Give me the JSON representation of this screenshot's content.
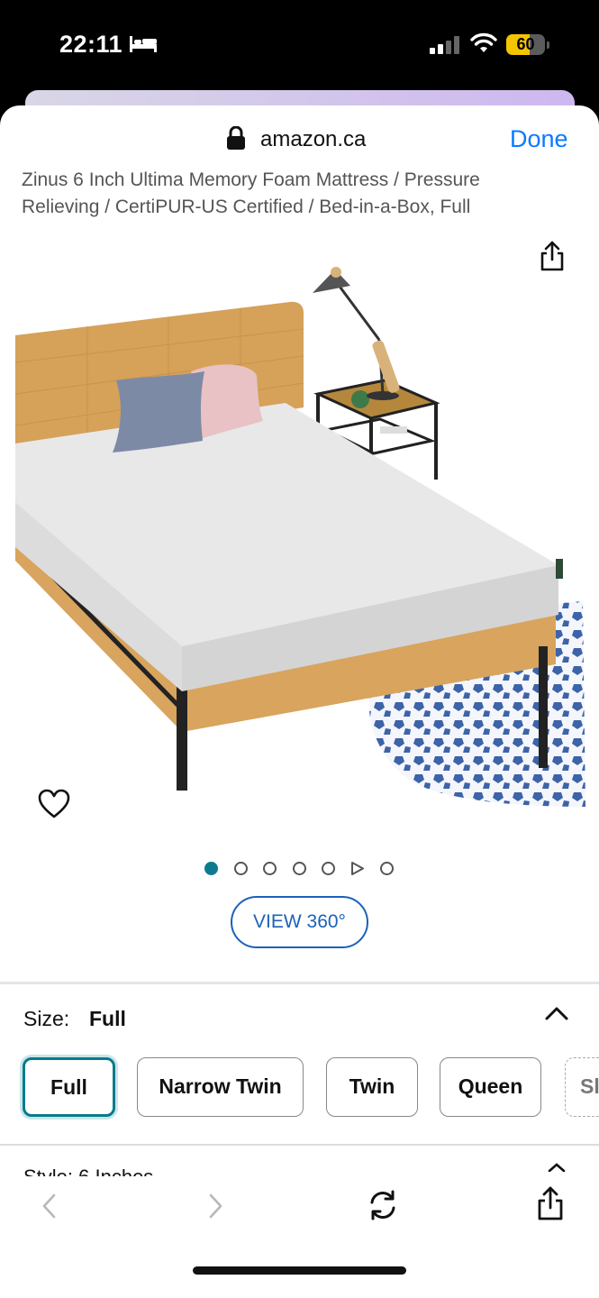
{
  "status_bar": {
    "time": "22:11",
    "battery_level": "60",
    "battery_fraction": 0.6,
    "icons": [
      "bed-icon",
      "signal-icon",
      "wifi-icon",
      "battery-icon"
    ]
  },
  "browser": {
    "url": "amazon.ca",
    "done_label": "Done"
  },
  "product": {
    "title": "Zinus 6 Inch Ultima Memory Foam Mattress / Pressure Relieving / CertiPUR-US Certified / Bed-in-a-Box, Full",
    "view360_label": "VIEW 360°",
    "carousel": {
      "total_dots": 7,
      "active_index": 0,
      "video_index": 5
    }
  },
  "size_selector": {
    "label": "Size:",
    "selected": "Full",
    "options": [
      "Full",
      "Narrow Twin",
      "Twin",
      "Queen",
      "Sl"
    ]
  },
  "style_peek": {
    "text": "Style: 6 Inches"
  },
  "colors": {
    "accent_link": "#0a7aff",
    "selected_border": "#087a8b",
    "view360_border": "#1b62b8",
    "battery_yellow": "#f5c400"
  }
}
